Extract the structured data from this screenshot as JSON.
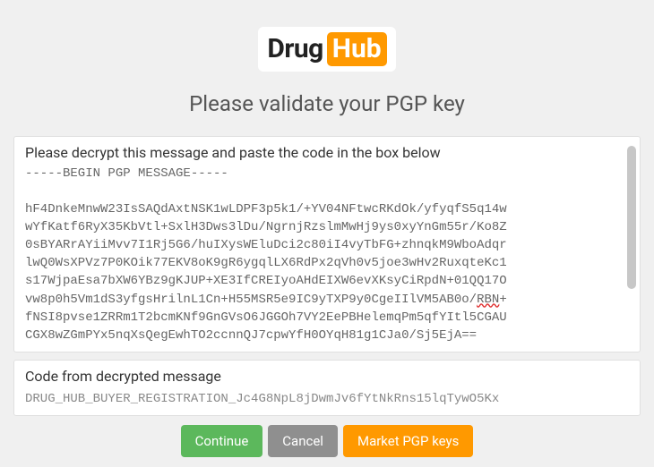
{
  "logo": {
    "part1": "Drug",
    "part2": "Hub"
  },
  "heading": "Please validate your PGP key",
  "pgp": {
    "label": "Please decrypt this message and paste the code in the box below",
    "begin": "-----BEGIN PGP MESSAGE-----",
    "lines": [
      "hF4DnkeMnwW23IsSAQdAxtNSK1wLDPF3p5k1/+YV04NFtwcRKdOk/yfyqfS5q14w",
      "wYfKatf6RyX35KbVtl+SxlH3Dws3lDu/NgrnjRzslmMwHj9ys0xyYnGm55r/Ko8Z",
      "0sBYARrAYiiMvv7I1Rj5G6/huIXysWEluDci2c80iI4vyTbFG+zhnqkM9WboAdqr",
      "lwQ0WsXPVz7P0KOik77EKV8oK9gR6ygqlLX6RdPx2qVh0v5joe3wHv2RuxqteKc1",
      "s17WjpaEsa7bXW6YBz9gKJUP+XE3IfCREIyoAHdEIXW6evXKsyCiRpdN+01QQ17O",
      "vw8p0h5Vm1dS3yfgsHrilnL1Cn+H55MSR5e9IC9yTXP9y0CgeIIlVM5AB0o/",
      "fNSI8pvse1ZRRm1T2bcmKNf9GnGVsO6JGGOh7VY2EePBHelemqPm5qfYItl5CGAU",
      "CGX8wZGmPYx5nqXsQegEwhTO2ccnnQJ7cpwYfH0OYqH81g1CJa0/Sj5EjA=="
    ],
    "squiggle": "RBN",
    "squiggle_after": "+"
  },
  "code": {
    "label": "Code from decrypted message",
    "value": "DRUG_HUB_BUYER_REGISTRATION_Jc4G8NpL8jDwmJv6fYtNkRns15lqTywO5Kx"
  },
  "buttons": {
    "continue": "Continue",
    "cancel": "Cancel",
    "market": "Market PGP keys"
  }
}
